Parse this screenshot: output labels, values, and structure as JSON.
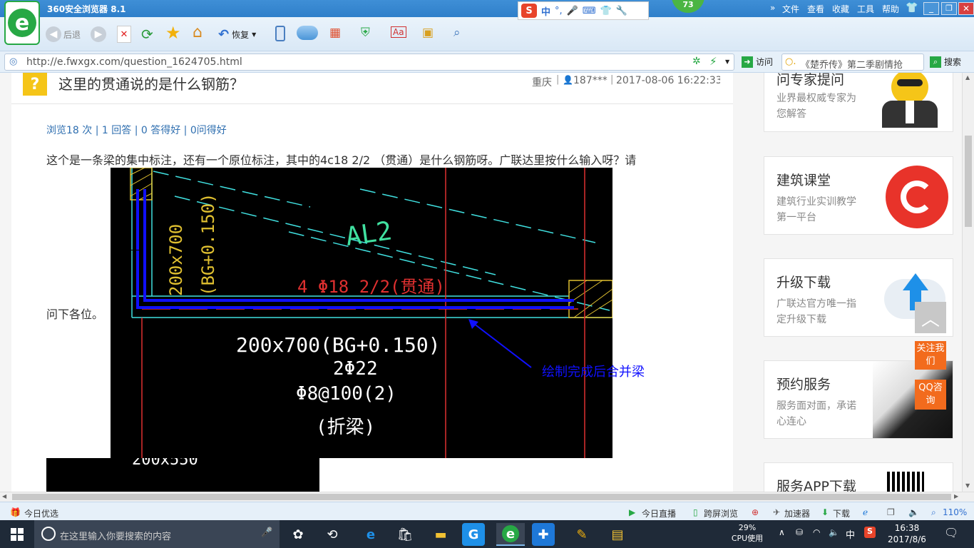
{
  "browser": {
    "title": "360安全浏览器 8.1",
    "badge": "73",
    "menu": [
      "文件",
      "查看",
      "收藏",
      "工具",
      "帮助"
    ],
    "ime": "中",
    "back_label": "后退",
    "restore_label": "恢复",
    "url": "http://e.fwxgx.com/question_1624705.html",
    "go_label": "访问",
    "search_value": "《楚乔传》第二季剧情抢",
    "search_label": "搜索"
  },
  "question": {
    "title": "这里的贯通说的是什么钢筋？",
    "location": "重庆",
    "user": "187***",
    "datetime": "2017-08-06 16:22:33",
    "stats": "浏览18 次 | 1 回答 | 0 答得好 | 0问得好",
    "body": "这个是一条梁的集中标注，还有一个原位标注，其中的4c18 2/2 （贯通）是什么钢筋呀。广联达里按什么输入呀？请",
    "body_end": "问下各位。"
  },
  "cad": {
    "beam_id": "AL2",
    "vertical_label1": "200x700",
    "vertical_label2": "(BG+0.150)",
    "red_label": "4 Φ18 2/2(贯通)",
    "spec1": "200x700(BG+0.150)",
    "spec2": "2Φ22",
    "spec3": "Φ8@100(2)",
    "spec4": "(折梁)",
    "lower_label": "200x550"
  },
  "annotation": "绘制完成后合并梁",
  "sidebar": {
    "cards": [
      {
        "title": "问专家提问",
        "desc": "业界最权威专家为您解答"
      },
      {
        "title": "建筑课堂",
        "desc": "建筑行业实训教学第一平台"
      },
      {
        "title": "升级下载",
        "desc": "广联达官方唯一指定升级下载"
      },
      {
        "title": "预约服务",
        "desc": "服务面对面，承诺心连心"
      },
      {
        "title": "服务APP下载",
        "desc": ""
      }
    ],
    "follow_label": "关注我们",
    "qq_label": "QQ咨询"
  },
  "status": {
    "left": "今日优选",
    "live": "今日直播",
    "cross": "跨屏浏览",
    "accel": "加速器",
    "download": "下载",
    "zoom": "110%"
  },
  "taskbar": {
    "search_placeholder": "在这里输入你要搜索的内容",
    "cpu_percent": "29%",
    "cpu_label": "CPU使用",
    "ime": "中",
    "time": "16:38",
    "date": "2017/8/6"
  },
  "colors": {
    "accent": "#2f7fca",
    "cad_red": "#e03030",
    "cad_cyan": "#40e0e0",
    "annotation_blue": "#1010ff",
    "orange": "#f26b1d"
  }
}
